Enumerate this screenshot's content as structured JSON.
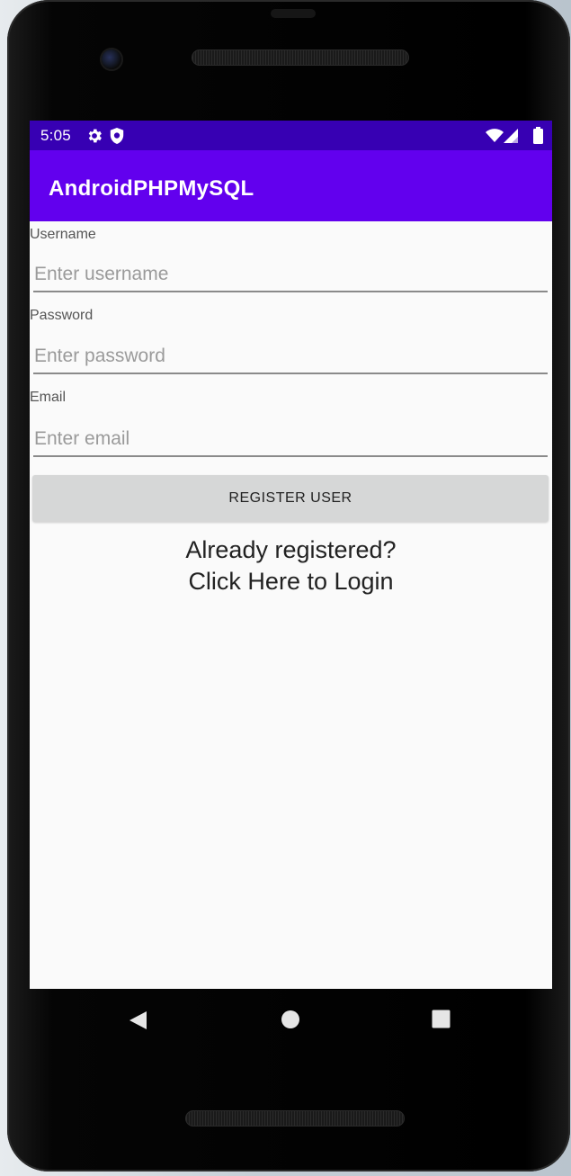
{
  "status_bar": {
    "time": "5:05",
    "icons": [
      "gear-icon",
      "shield-icon",
      "wifi-icon",
      "signal-icon",
      "battery-icon"
    ]
  },
  "app_bar": {
    "title": "AndroidPHPMySQL"
  },
  "form": {
    "username_label": "Username",
    "username_placeholder": "Enter username",
    "password_label": "Password",
    "password_placeholder": "Enter password",
    "email_label": "Email",
    "email_placeholder": "Enter email",
    "register_button": "REGISTER USER",
    "login_link_line1": "Already registered?",
    "login_link_line2": "Click Here to Login"
  },
  "nav_bar": {
    "icons": [
      "back-triangle-icon",
      "home-circle-icon",
      "recents-square-icon"
    ]
  },
  "colors": {
    "status_bar": "#3700b3",
    "app_bar": "#6200ee",
    "button": "#d6d7d7",
    "screen_background": "#fafafa"
  }
}
